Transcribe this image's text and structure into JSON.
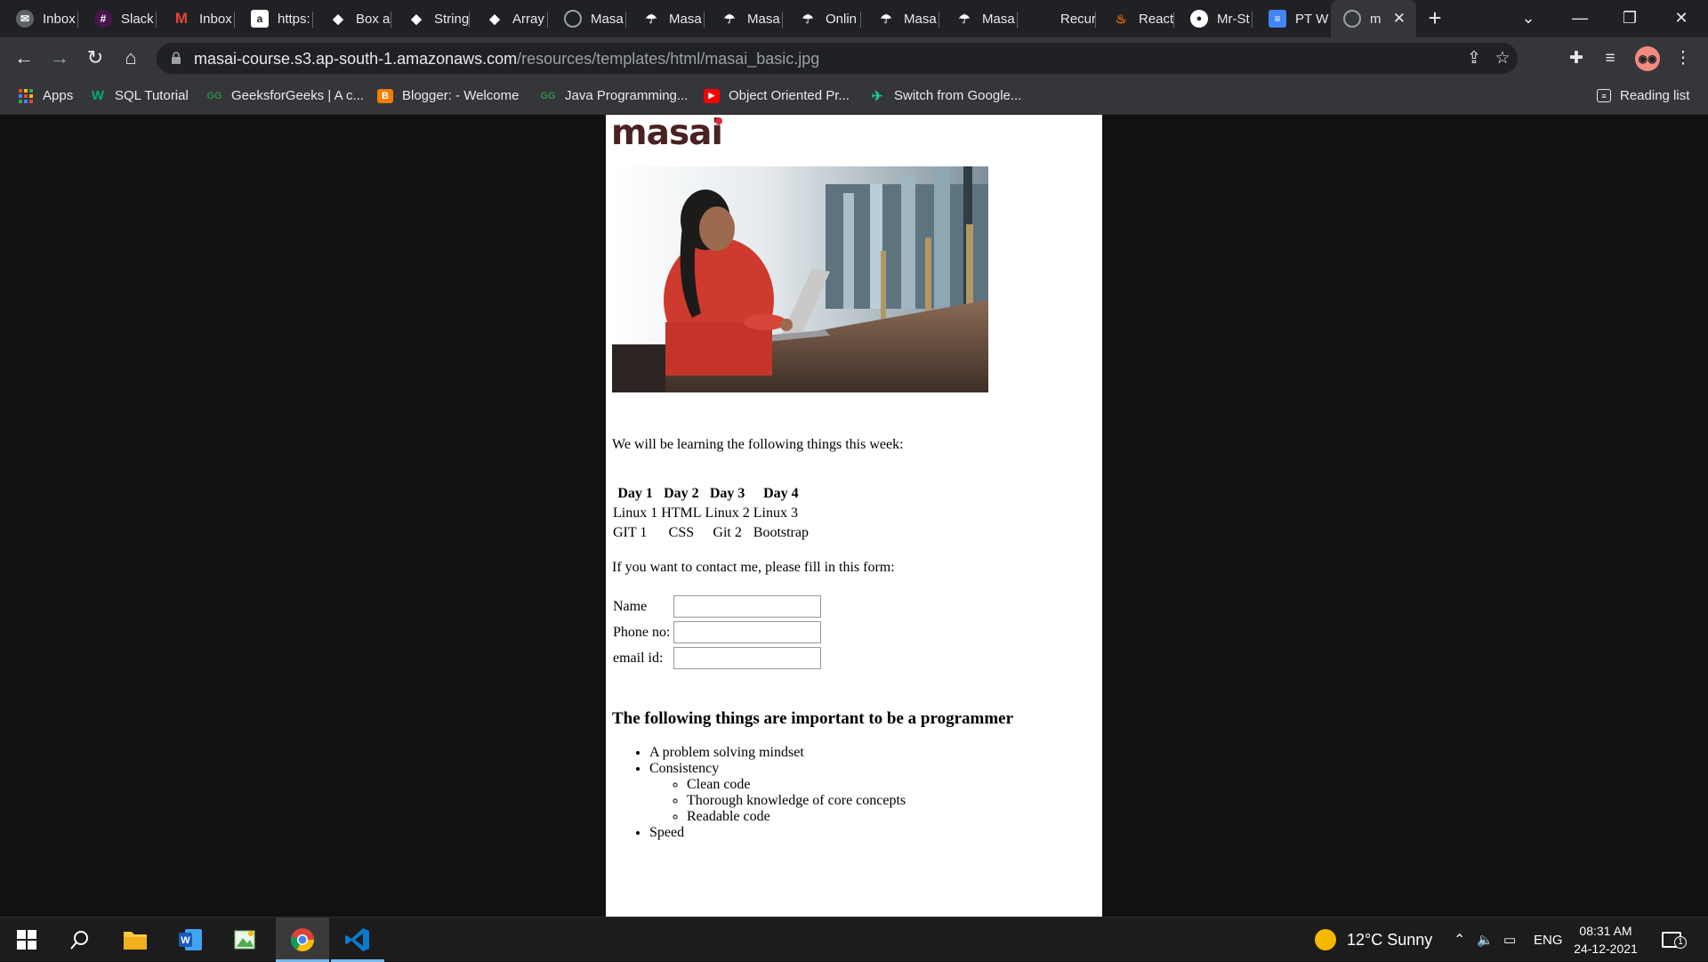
{
  "tabs": [
    {
      "label": "Inbox",
      "icon": "mail-icon",
      "color": "#5f6368"
    },
    {
      "label": "Slack",
      "icon": "slack-icon",
      "color": "#4a154b"
    },
    {
      "label": "Inbox",
      "icon": "gmail-icon",
      "color": "#ea4335"
    },
    {
      "label": "https:",
      "icon": "a-icon",
      "color": "#ffffff"
    },
    {
      "label": "Box a",
      "icon": "codepen-icon",
      "color": "#ffffff"
    },
    {
      "label": "String",
      "icon": "codepen-icon",
      "color": "#ffffff"
    },
    {
      "label": "Array",
      "icon": "codepen-icon",
      "color": "#ffffff"
    },
    {
      "label": "Masa",
      "icon": "globe-icon",
      "color": "#9aa0a6"
    },
    {
      "label": "Masa",
      "icon": "masai-icon",
      "color": "#ffffff"
    },
    {
      "label": "Masa",
      "icon": "masai-icon",
      "color": "#ffffff"
    },
    {
      "label": "Onlin",
      "icon": "masai-icon",
      "color": "#ffffff"
    },
    {
      "label": "Masa",
      "icon": "masai-icon",
      "color": "#ffffff"
    },
    {
      "label": "Masa",
      "icon": "masai-icon",
      "color": "#ffffff"
    },
    {
      "label": "Recur",
      "icon": "blank-icon",
      "color": "#202124"
    },
    {
      "label": "React",
      "icon": "java-icon",
      "color": "#e76f00"
    },
    {
      "label": "Mr-St",
      "icon": "github-icon",
      "color": "#ffffff"
    },
    {
      "label": "PT W",
      "icon": "docs-icon",
      "color": "#4285f4"
    },
    {
      "label": "m",
      "icon": "globe-icon",
      "color": "#9aa0a6"
    }
  ],
  "url": {
    "host": "masai-course.s3.ap-south-1.amazonaws.com",
    "path": "/resources/templates/html/masai_basic.jpg"
  },
  "bookmarks": [
    {
      "label": "Apps",
      "icon": "apps-grid-icon"
    },
    {
      "label": "SQL Tutorial",
      "icon": "w3schools-icon"
    },
    {
      "label": "GeeksforGeeks | A c...",
      "icon": "geeksforgeeks-icon"
    },
    {
      "label": "Blogger: - Welcome",
      "icon": "blogger-icon"
    },
    {
      "label": "Java Programming...",
      "icon": "geeksforgeeks-icon"
    },
    {
      "label": "Object Oriented Pr...",
      "icon": "youtube-icon"
    },
    {
      "label": "Switch from Google...",
      "icon": "switch-icon"
    }
  ],
  "reading_list": "Reading list",
  "page": {
    "logo": "masai",
    "intro": "We will be learning the following things this week:",
    "schedule": {
      "headers": [
        "Day 1",
        "Day 2",
        "Day 3",
        "Day 4"
      ],
      "rows": [
        [
          "Linux 1",
          "HTML",
          "Linux 2",
          "Linux 3"
        ],
        [
          "GIT 1",
          "CSS",
          "Git 2",
          "Bootstrap"
        ]
      ]
    },
    "contact_text": "If you want to contact me, please fill in this form:",
    "form_labels": [
      "Name",
      "Phone no:",
      "email id:"
    ],
    "heading": "The following things are important to be a programmer",
    "list": {
      "item1": "A problem solving mindset",
      "item2": "Consistency",
      "sub": [
        "Clean code",
        "Thorough knowledge of core concepts",
        "Readable code"
      ],
      "item3": "Speed"
    }
  },
  "taskbar": {
    "weather": "12°C  Sunny",
    "lang": "ENG",
    "time": "08:31 AM",
    "date": "24-12-2021",
    "notifications": "1"
  }
}
